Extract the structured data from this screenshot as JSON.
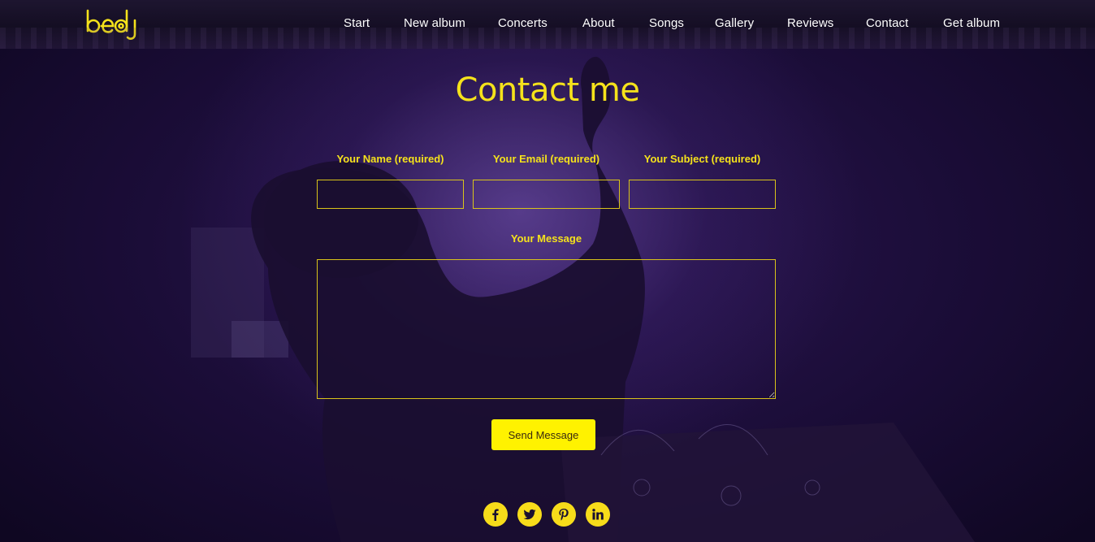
{
  "brand": {
    "logo_text": "bedj",
    "accent_color": "#f5e21b"
  },
  "nav": {
    "items": [
      {
        "label": "Start"
      },
      {
        "label": "New album"
      },
      {
        "label": "Concerts"
      },
      {
        "label": "About"
      },
      {
        "label": "Songs"
      },
      {
        "label": "Gallery"
      },
      {
        "label": "Reviews"
      },
      {
        "label": "Contact"
      },
      {
        "label": "Get album"
      }
    ]
  },
  "contact": {
    "title": "Contact me",
    "name_label": "Your Name (required)",
    "name_value": "",
    "email_label": "Your Email (required)",
    "email_value": "",
    "subject_label": "Your Subject (required)",
    "subject_value": "",
    "message_label": "Your Message",
    "message_value": "",
    "send_label": "Send Message"
  },
  "social": {
    "icons": [
      "facebook-icon",
      "twitter-icon",
      "pinterest-icon",
      "linkedin-icon"
    ]
  }
}
